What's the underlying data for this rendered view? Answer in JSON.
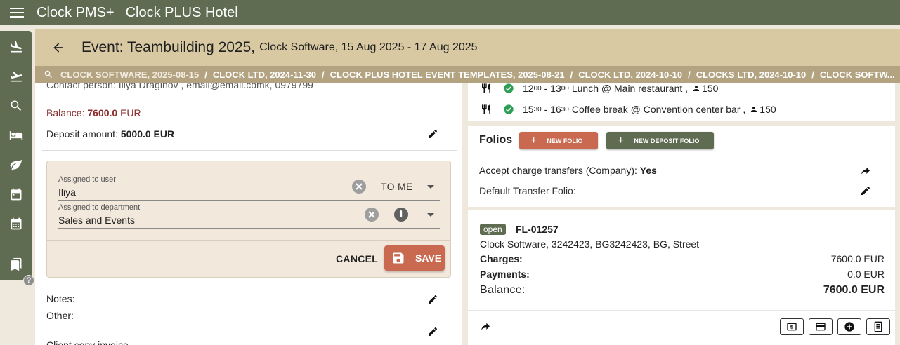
{
  "topbar": {
    "app_name": "Clock PMS+",
    "hotel_name": "Clock PLUS Hotel",
    "menu_icon": "hamburger-icon"
  },
  "sidebar": {
    "items": [
      {
        "icon": "arrivals-icon"
      },
      {
        "icon": "departures-icon"
      },
      {
        "icon": "search-icon"
      },
      {
        "icon": "bed-icon"
      },
      {
        "icon": "leaf-icon"
      },
      {
        "icon": "calendar-icon"
      },
      {
        "icon": "calendar-grid-icon"
      },
      {
        "icon": "bookmarks-icon"
      }
    ],
    "help_label": "?"
  },
  "header": {
    "title": "Event: Teambuilding 2025,",
    "subtitle": "Clock Software, 15 Aug 2025 - 17 Aug 2025"
  },
  "breadcrumb": {
    "items": [
      "CLOCK SOFTWARE, 2025-08-15",
      "CLOCK LTD, 2024-11-30",
      "CLOCK PLUS HOTEL EVENT TEMPLATES, 2025-08-21",
      "CLOCK LTD, 2024-10-10",
      "CLOCKS LTD, 2024-10-10",
      "CLOCK SOFTW..."
    ],
    "separator": "/"
  },
  "event_details": {
    "contact_line": "Contact person: Iliya Draginov , email@email.comk, 0979799",
    "balance_label": "Balance:",
    "balance_value": "7600.0",
    "balance_currency": "EUR",
    "deposit_label": "Deposit amount:",
    "deposit_value": "5000.0 EUR"
  },
  "assignment": {
    "user_label": "Assigned to user",
    "user_value": "Iliya",
    "to_me_label": "TO ME",
    "department_label": "Assigned to department",
    "department_value": "Sales and Events",
    "cancel_label": "CANCEL",
    "save_label": "SAVE"
  },
  "notes": {
    "notes_label": "Notes:",
    "other_label": "Other:",
    "cut_label": "Client copy invoice"
  },
  "schedule": [
    {
      "start_h": "12",
      "start_m": "00",
      "end_h": "13",
      "end_m": "00",
      "text": "Lunch @ Main restaurant ,",
      "count": "150"
    },
    {
      "start_h": "15",
      "start_m": "30",
      "end_h": "16",
      "end_m": "30",
      "text": "Coffee break @ Convention center bar ,",
      "count": "150"
    }
  ],
  "folios": {
    "title": "Folios",
    "new_folio_label": "NEW FOLIO",
    "new_deposit_label": "NEW DEPOSIT FOLIO",
    "accept_label": "Accept charge transfers (Company):",
    "accept_value": "Yes",
    "default_transfer_label": "Default Transfer Folio:"
  },
  "folio_card": {
    "status": "open",
    "number": "FL-01257",
    "address": "Clock Software, 3242423, BG3242423, BG, Street",
    "charges_label": "Charges:",
    "charges_value": "7600.0 EUR",
    "payments_label": "Payments:",
    "payments_value": "0.0 EUR",
    "balance_label": "Balance:",
    "balance_value": "7600.0 EUR"
  },
  "colors": {
    "primary_green": "#5f6c52",
    "header_tan": "#d8c9a3",
    "breadcrumb_tan": "#b3a381",
    "accent_red": "#c9694f",
    "balance_red": "#8a2c2c",
    "check_green": "#2e9d55"
  }
}
